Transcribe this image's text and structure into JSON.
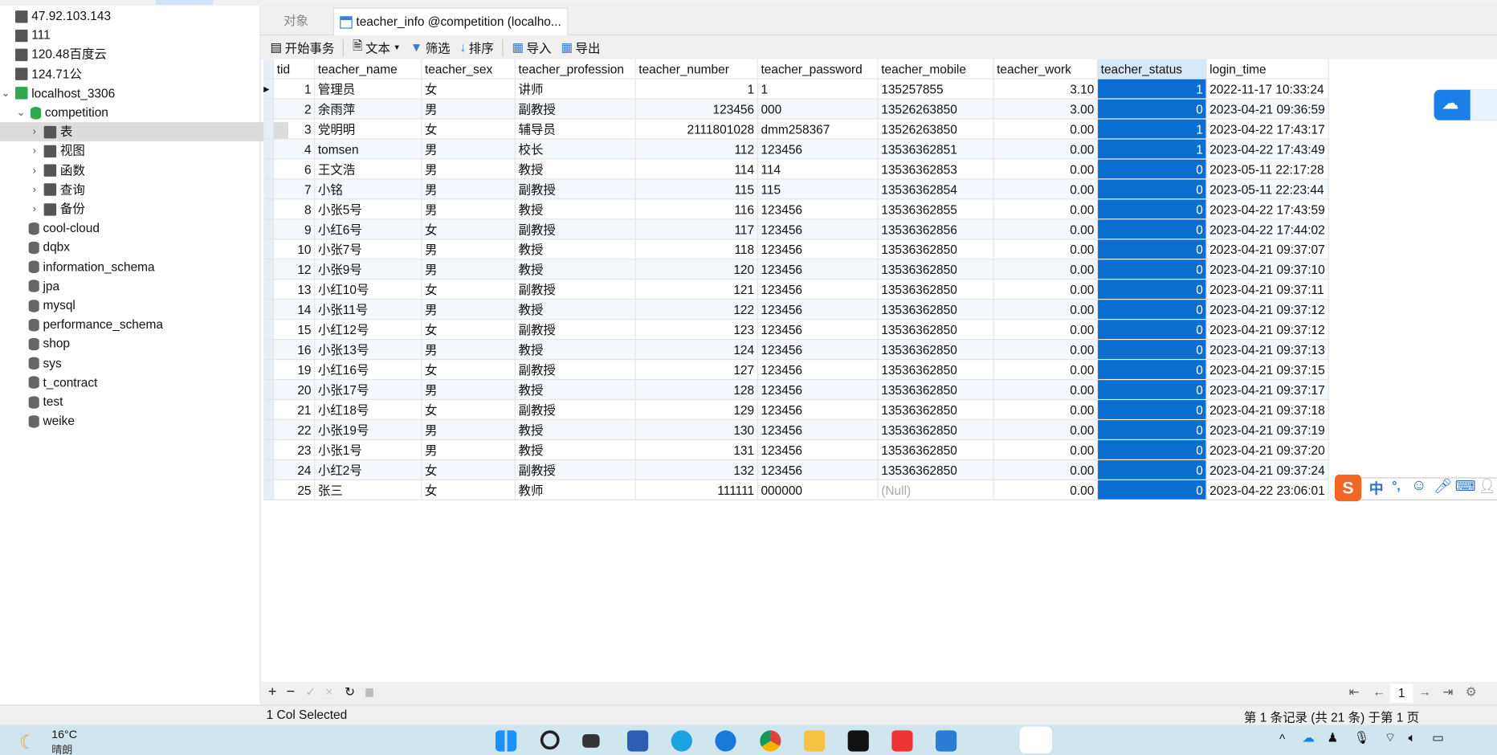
{
  "sidebar": {
    "connections": [
      "47.92.103.143",
      "111",
      "120.48百度云",
      "124.71公"
    ],
    "localhost": "localhost_3306",
    "current_db": "competition",
    "db_children": [
      "表",
      "视图",
      "函数",
      "查询",
      "备份"
    ],
    "databases": [
      "cool-cloud",
      "dqbx",
      "information_schema",
      "jpa",
      "mysql",
      "performance_schema",
      "shop",
      "sys",
      "t_contract",
      "test",
      "weike"
    ]
  },
  "tabs": {
    "objects": "对象",
    "active": "teacher_info @competition (localho..."
  },
  "toolbar": {
    "begin_tx": "开始事务",
    "text": "文本",
    "filter": "筛选",
    "sort": "排序",
    "import": "导入",
    "export": "导出"
  },
  "table": {
    "columns": [
      "tid",
      "teacher_name",
      "teacher_sex",
      "teacher_profession",
      "teacher_number",
      "teacher_password",
      "teacher_mobile",
      "teacher_work",
      "teacher_status",
      "login_time"
    ],
    "rows": [
      [
        "1",
        "管理员",
        "女",
        "讲师",
        "1",
        "1",
        "135257855",
        "3.10",
        "1",
        "2022-11-17 10:33:24"
      ],
      [
        "2",
        "余雨萍",
        "男",
        "副教授",
        "123456",
        "000",
        "13526263850",
        "3.00",
        "0",
        "2023-04-21 09:36:59"
      ],
      [
        "3",
        "党明明",
        "女",
        "辅导员",
        "2111801028",
        "dmm258367",
        "13526263850",
        "0.00",
        "1",
        "2023-04-22 17:43:17"
      ],
      [
        "4",
        "tomsen",
        "男",
        "校长",
        "112",
        "123456",
        "13536362851",
        "0.00",
        "1",
        "2023-04-22 17:43:49"
      ],
      [
        "6",
        "王文浩",
        "男",
        "教授",
        "114",
        "114",
        "13536362853",
        "0.00",
        "0",
        "2023-05-11 22:17:28"
      ],
      [
        "7",
        "小铭",
        "男",
        "副教授",
        "115",
        "115",
        "13536362854",
        "0.00",
        "0",
        "2023-05-11 22:23:44"
      ],
      [
        "8",
        "小张5号",
        "男",
        "教授",
        "116",
        "123456",
        "13536362855",
        "0.00",
        "0",
        "2023-04-22 17:43:59"
      ],
      [
        "9",
        "小红6号",
        "女",
        "副教授",
        "117",
        "123456",
        "13536362856",
        "0.00",
        "0",
        "2023-04-22 17:44:02"
      ],
      [
        "10",
        "小张7号",
        "男",
        "教授",
        "118",
        "123456",
        "13536362850",
        "0.00",
        "0",
        "2023-04-21 09:37:07"
      ],
      [
        "12",
        "小张9号",
        "男",
        "教授",
        "120",
        "123456",
        "13536362850",
        "0.00",
        "0",
        "2023-04-21 09:37:10"
      ],
      [
        "13",
        "小红10号",
        "女",
        "副教授",
        "121",
        "123456",
        "13536362850",
        "0.00",
        "0",
        "2023-04-21 09:37:11"
      ],
      [
        "14",
        "小张11号",
        "男",
        "教授",
        "122",
        "123456",
        "13536362850",
        "0.00",
        "0",
        "2023-04-21 09:37:12"
      ],
      [
        "15",
        "小红12号",
        "女",
        "副教授",
        "123",
        "123456",
        "13536362850",
        "0.00",
        "0",
        "2023-04-21 09:37:12"
      ],
      [
        "16",
        "小张13号",
        "男",
        "教授",
        "124",
        "123456",
        "13536362850",
        "0.00",
        "0",
        "2023-04-21 09:37:13"
      ],
      [
        "19",
        "小红16号",
        "女",
        "副教授",
        "127",
        "123456",
        "13536362850",
        "0.00",
        "0",
        "2023-04-21 09:37:15"
      ],
      [
        "20",
        "小张17号",
        "男",
        "教授",
        "128",
        "123456",
        "13536362850",
        "0.00",
        "0",
        "2023-04-21 09:37:17"
      ],
      [
        "21",
        "小红18号",
        "女",
        "副教授",
        "129",
        "123456",
        "13536362850",
        "0.00",
        "0",
        "2023-04-21 09:37:18"
      ],
      [
        "22",
        "小张19号",
        "男",
        "教授",
        "130",
        "123456",
        "13536362850",
        "0.00",
        "0",
        "2023-04-21 09:37:19"
      ],
      [
        "23",
        "小张1号",
        "男",
        "教授",
        "131",
        "123456",
        "13536362850",
        "0.00",
        "0",
        "2023-04-21 09:37:20"
      ],
      [
        "24",
        "小红2号",
        "女",
        "副教授",
        "132",
        "123456",
        "13536362850",
        "0.00",
        "0",
        "2023-04-21 09:37:24"
      ],
      [
        "25",
        "张三",
        "女",
        "教师",
        "111111",
        "000000",
        "(Null)",
        "0.00",
        "0",
        "2023-04-22 23:06:01"
      ]
    ]
  },
  "pager": {
    "page": "1"
  },
  "status": {
    "left": "1 Col Selected",
    "right": "第 1 条记录 (共 21 条) 于第 1 页"
  },
  "ime": {
    "mode": "中",
    "punct": "°,"
  },
  "taskbar": {
    "temp": "16°C",
    "weather": "晴朗"
  },
  "colors": {
    "selection": "#0a6ed1",
    "taskbar": "#cfe6ee"
  }
}
